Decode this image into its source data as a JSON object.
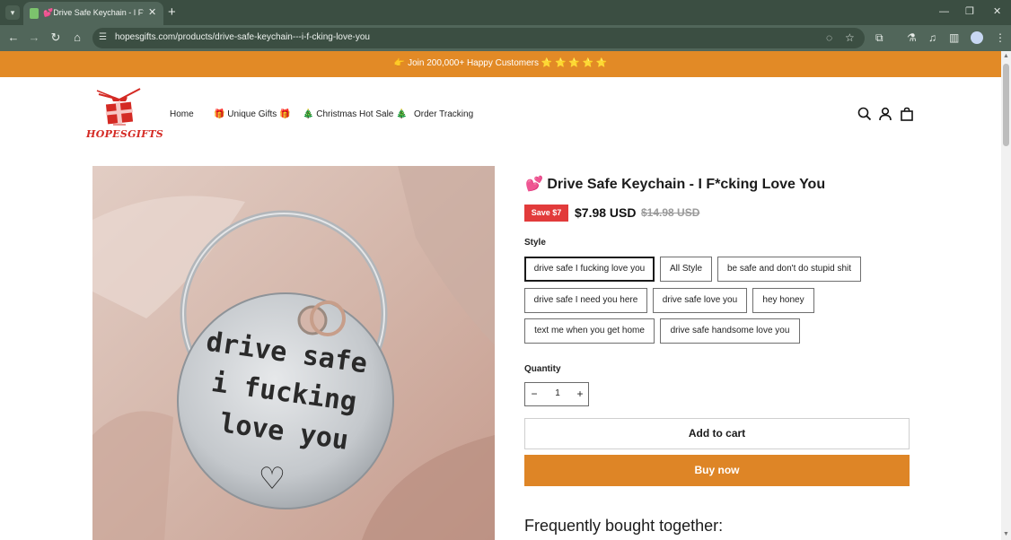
{
  "browser": {
    "tab_title": "💕Drive Safe Keychain - I F*cking Love You",
    "tab_close": "✕",
    "new_tab": "+",
    "url": "hopesgifts.com/products/drive-safe-keychain---i-f-cking-love-you",
    "icons": [
      "tab-list-icon",
      "back-arrow-icon",
      "forward-arrow-icon",
      "reload-icon",
      "home-icon",
      "site-info-icon",
      "eye-off-icon",
      "star-bookmark-icon",
      "extensions-icon",
      "labs-icon",
      "media-icon",
      "side-panel-icon",
      "profile-avatar-icon",
      "menu-kebab-icon",
      "minimize-icon",
      "restore-icon",
      "close-window-icon"
    ]
  },
  "announcement": {
    "text": "👉 Join 200,000+ Happy Customers ⭐ ⭐ ⭐ ⭐ ⭐"
  },
  "header": {
    "logo_text": "HOPESGIFTS",
    "nav": [
      {
        "label": "Home"
      },
      {
        "label": "🎁 Unique Gifts 🎁"
      },
      {
        "label": "🎄 Christmas Hot Sale 🎄"
      },
      {
        "label": "Order Tracking"
      }
    ],
    "icons": [
      "search-icon",
      "account-icon",
      "cart-bag-icon"
    ]
  },
  "product": {
    "image_text": {
      "line1": "drive safe",
      "line2": "i fucking",
      "line3": "love you",
      "heart": "♡"
    },
    "title_emoji": "💕",
    "title": "Drive Safe Keychain - I F*cking Love You",
    "save_badge": "Save $7",
    "price": "$7.98 USD",
    "compare_price": "$14.98 USD",
    "style_label": "Style",
    "selected_style": "drive safe I fucking love you",
    "styles": [
      {
        "label": "drive safe I fucking love you"
      },
      {
        "label": "All Style"
      },
      {
        "label": "be safe and don't do stupid shit"
      },
      {
        "label": "drive safe I need you here"
      },
      {
        "label": "drive safe love you"
      },
      {
        "label": "hey honey"
      },
      {
        "label": "text me when you get home"
      },
      {
        "label": "drive safe handsome love you"
      }
    ],
    "quantity_label": "Quantity",
    "quantity": "1",
    "qty_minus": "−",
    "qty_plus": "+",
    "add_to_cart": "Add to cart",
    "buy_now": "Buy now",
    "frequently_bought": "Frequently bought together:"
  },
  "colors": {
    "announcement_bg": "#e28a26",
    "buy_now_bg": "#de8526",
    "save_badge_bg": "#e23b3b",
    "browser_chrome": "#51665a",
    "logo_red": "#d42a24"
  }
}
